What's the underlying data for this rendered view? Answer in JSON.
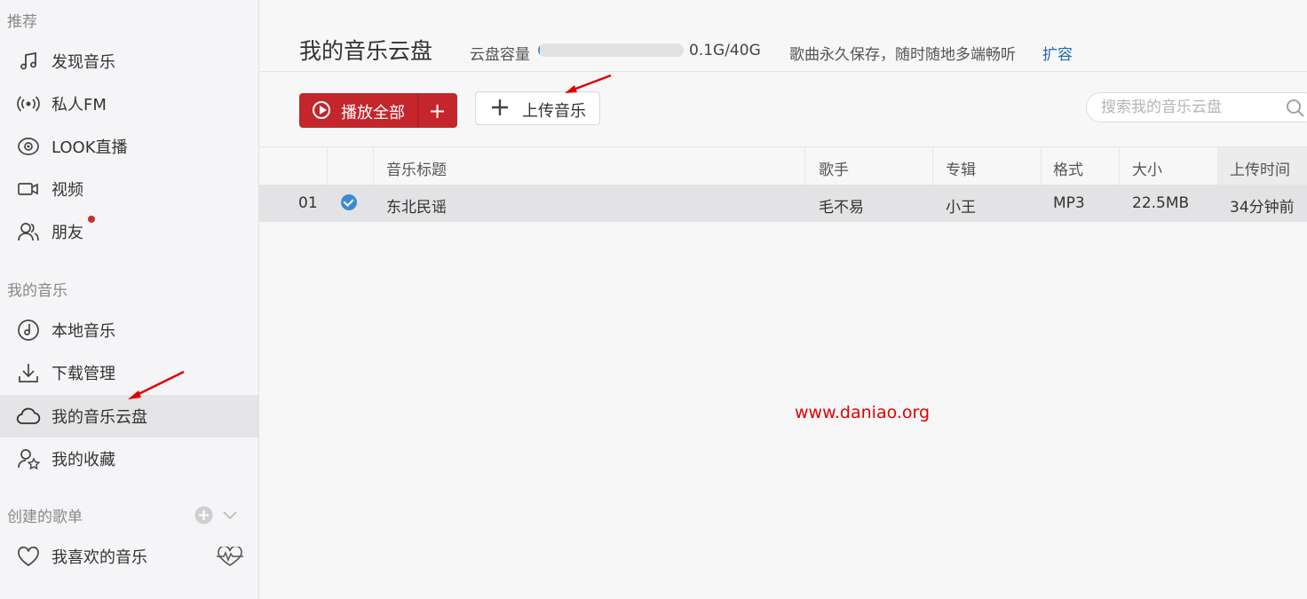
{
  "sidebar": {
    "section_recommend": "推荐",
    "recommend_items": [
      {
        "label": "发现音乐",
        "icon": "music-note-icon"
      },
      {
        "label": "私人FM",
        "icon": "radio-icon"
      },
      {
        "label": "LOOK直播",
        "icon": "live-eye-icon"
      },
      {
        "label": "视频",
        "icon": "video-icon"
      },
      {
        "label": "朋友",
        "icon": "friends-icon",
        "has_dot": true
      }
    ],
    "section_my_music": "我的音乐",
    "my_music_items": [
      {
        "label": "本地音乐",
        "icon": "local-music-icon"
      },
      {
        "label": "下载管理",
        "icon": "download-icon"
      },
      {
        "label": "我的音乐云盘",
        "icon": "cloud-icon",
        "active": true
      },
      {
        "label": "我的收藏",
        "icon": "collection-icon"
      }
    ],
    "section_playlists": "创建的歌单",
    "playlist_items": [
      {
        "label": "我喜欢的音乐",
        "icon": "heart-icon"
      }
    ]
  },
  "header": {
    "title": "我的音乐云盘",
    "capacity_label": "云盘容量",
    "capacity_fraction": 0.0025,
    "capacity_text": "0.1G/40G",
    "capacity_desc": "歌曲永久保存，随时随地多端畅听",
    "expand_link": "扩容"
  },
  "toolbar": {
    "play_all_label": "播放全部",
    "add_symbol": "+",
    "upload_label": "上传音乐",
    "search_placeholder": "搜索我的音乐云盘"
  },
  "table": {
    "columns": [
      "音乐标题",
      "歌手",
      "专辑",
      "格式",
      "大小",
      "上传时间"
    ],
    "rows": [
      {
        "index": "01",
        "title": "东北民谣",
        "artist": "毛不易",
        "album": "小王",
        "format": "MP3",
        "size": "22.5MB",
        "uploaded": "34分钟前"
      }
    ]
  },
  "watermark": "www.daniao.org",
  "colors": {
    "accent": "#c3262b",
    "link": "#1f6bb0",
    "check": "#3b8bd4",
    "annotation": "#e00000"
  }
}
